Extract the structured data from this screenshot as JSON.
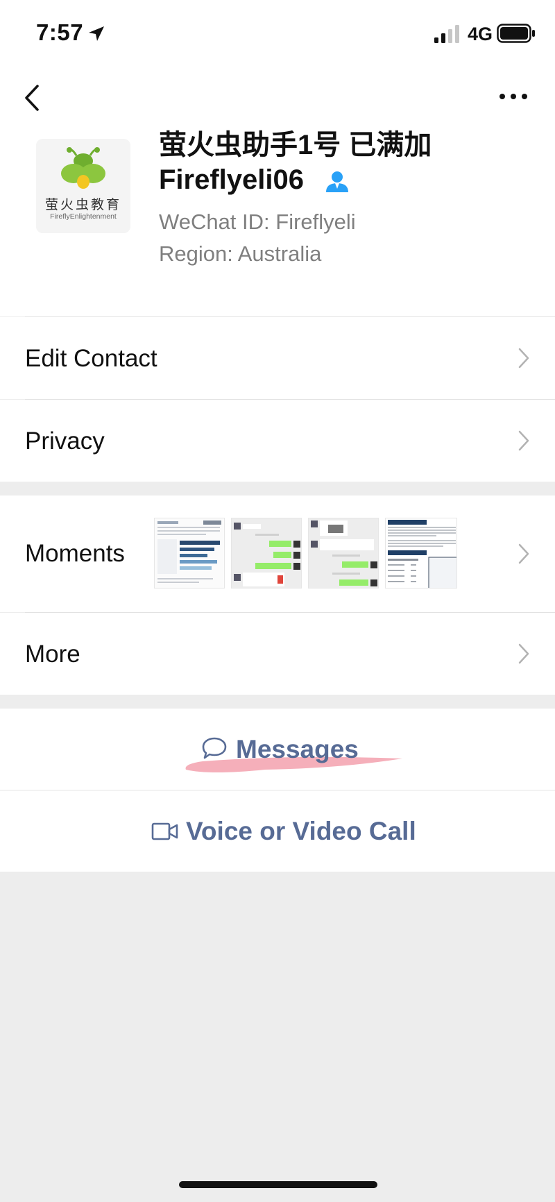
{
  "status_bar": {
    "time": "7:57",
    "network": "4G",
    "icons": [
      "location-arrow-icon",
      "signal-icon",
      "battery-icon"
    ]
  },
  "profile": {
    "name": "萤火虫助手1号 已满加Fireflyeli06",
    "wechat_id": "WeChat ID: Fireflyeli",
    "region": "Region: Australia",
    "avatar": {
      "caption_cn": "萤火虫教育",
      "caption_en": "FireflyEnlightenment"
    }
  },
  "menu": {
    "edit_contact": "Edit Contact",
    "privacy": "Privacy",
    "moments": "Moments",
    "more": "More"
  },
  "actions": {
    "messages": "Messages",
    "voice_video_call": "Voice or Video Call"
  },
  "colors": {
    "link_blue": "#576b95",
    "page_background": "#ededed",
    "highlight_pink": "#f4a6b3",
    "person_icon_blue": "#29a1f7"
  }
}
